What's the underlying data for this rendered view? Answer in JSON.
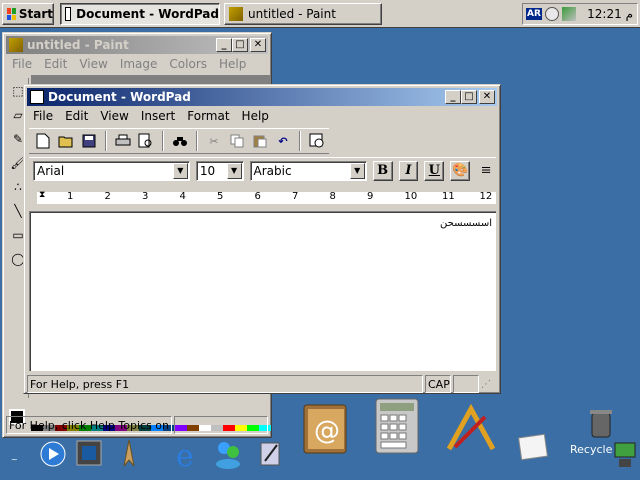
{
  "taskbar": {
    "start_label": "Start",
    "tasks": [
      {
        "label": "Document - WordPad",
        "icon": "wordpad-icon",
        "active": true
      },
      {
        "label": "untitled - Paint",
        "icon": "paint-icon",
        "active": false
      }
    ],
    "tray": {
      "language": "AR",
      "clock": "12:21 م"
    }
  },
  "paint": {
    "title": "untitled - Paint",
    "menu": [
      "File",
      "Edit",
      "View",
      "Image",
      "Colors",
      "Help"
    ],
    "status_text": "For Help, click Help Topics on the H",
    "palette_colors": [
      "#000000",
      "#808080",
      "#800000",
      "#808000",
      "#008000",
      "#008080",
      "#000080",
      "#800080",
      "#808040",
      "#004040",
      "#0080ff",
      "#004080",
      "#8000ff",
      "#804000",
      "#ffffff",
      "#c0c0c0",
      "#ff0000",
      "#ffff00",
      "#00ff00",
      "#00ffff"
    ]
  },
  "wordpad": {
    "title": "Document - WordPad",
    "menu": [
      "File",
      "Edit",
      "View",
      "Insert",
      "Format",
      "Help"
    ],
    "toolbar_icons": [
      "new-icon",
      "open-icon",
      "save-icon",
      "print-icon",
      "print-preview-icon",
      "find-icon",
      "cut-icon",
      "copy-icon",
      "paste-icon",
      "undo-icon",
      "date-time-icon"
    ],
    "font_name": "Arial",
    "font_size": "10",
    "script": "Arabic",
    "format_buttons": {
      "bold": "B",
      "italic": "I",
      "underline": "U"
    },
    "ruler_numbers": [
      "1",
      "2",
      "3",
      "4",
      "5",
      "6",
      "7",
      "8",
      "9",
      "10",
      "11",
      "12"
    ],
    "document_text": "اسسسسحن",
    "status_text": "For Help, press F1",
    "caps_indicator": "CAP"
  },
  "desktop": {
    "recycle_label": "Recycle"
  }
}
